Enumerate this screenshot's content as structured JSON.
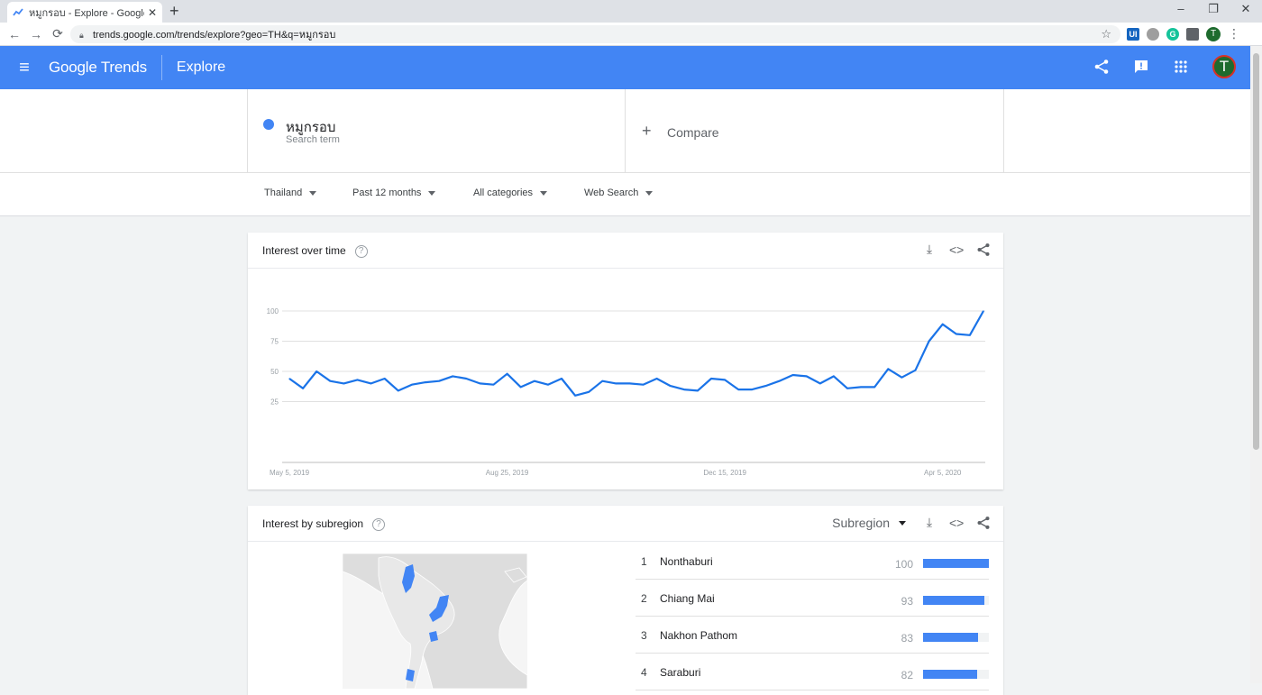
{
  "browser": {
    "tab_title": "หมูกรอบ - Explore - Google Trend",
    "tab_close": "✕",
    "new_tab": "+",
    "url": "trends.google.com/trends/explore?geo=TH&q=หมูกรอบ",
    "window_controls": [
      "–",
      "❐",
      "✕"
    ],
    "profile_initial": "T"
  },
  "header": {
    "logo": "Google Trends",
    "section": "Explore",
    "avatar_initial": "T",
    "brand_color": "#4285f4"
  },
  "search": {
    "term": "หมูกรอบ",
    "term_sub": "Search term",
    "compare_label": "Compare"
  },
  "filters": {
    "region": "Thailand",
    "period": "Past 12 months",
    "category": "All categories",
    "search_type": "Web Search"
  },
  "interest_over_time": {
    "title": "Interest over time"
  },
  "chart_data": {
    "type": "line",
    "x_ticks": [
      "May 5, 2019",
      "Aug 25, 2019",
      "Dec 15, 2019",
      "Apr 5, 2020"
    ],
    "x_tick_index": [
      0,
      16,
      32,
      48
    ],
    "y_ticks": [
      "100",
      "75",
      "50",
      "25"
    ],
    "ylim": [
      0,
      100
    ],
    "line_color": "#1a73e8",
    "series": [
      {
        "values": [
          44,
          36,
          50,
          42,
          40,
          43,
          40,
          44,
          34,
          39,
          41,
          42,
          46,
          44,
          40,
          39,
          48,
          37,
          42,
          39,
          44,
          30,
          33,
          42,
          40,
          40,
          39,
          44,
          38,
          35,
          34,
          44,
          43,
          35,
          35,
          38,
          42,
          47,
          46,
          40,
          46,
          36,
          37,
          37,
          52,
          45,
          51,
          75,
          89,
          81,
          80,
          100
        ]
      }
    ]
  },
  "interest_by_subregion": {
    "title": "Interest by subregion",
    "selector": "Subregion",
    "rows": [
      {
        "rank": "1",
        "name": "Nonthaburi",
        "value": "100",
        "fraction": 1.0
      },
      {
        "rank": "2",
        "name": "Chiang Mai",
        "value": "93",
        "fraction": 0.93
      },
      {
        "rank": "3",
        "name": "Nakhon Pathom",
        "value": "83",
        "fraction": 0.83
      },
      {
        "rank": "4",
        "name": "Saraburi",
        "value": "82",
        "fraction": 0.82
      }
    ],
    "map_fill": "#e0e0e0",
    "map_highlight": "#4285f4"
  }
}
